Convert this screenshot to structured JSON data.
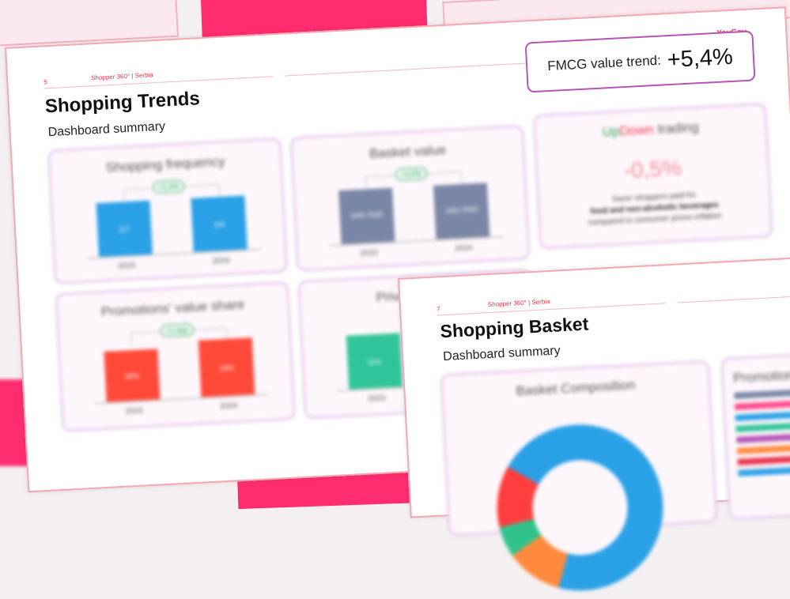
{
  "slide1": {
    "number": "5",
    "crumb": "Shopper 360° | Serbia",
    "brand": "YouGov",
    "title": "Shopping Trends",
    "subtitle": "Dashboard summary",
    "trend_label": "FMCG value trend:",
    "trend_value": "+5,4%",
    "cards": {
      "frequency": {
        "title": "Shopping frequency",
        "delta": "+1,4%",
        "bar1": "117",
        "bar2": "119",
        "year1": "2023",
        "year2": "2024"
      },
      "basket": {
        "title": "Basket value",
        "delta": "+4,0%",
        "bar1": "1491 RSD",
        "bar2": "1551 RSD",
        "year1": "2023",
        "year2": "2024"
      },
      "updown": {
        "title_up": "Up",
        "title_down": "Down",
        "title_rest": " trading",
        "value": "-0,5%",
        "line1": "Saver shoppers paid for",
        "line2": "food and non-alcoholic beverages",
        "line3": "compared to consumer prices inflation"
      },
      "promotions": {
        "title": "Promotions' value share",
        "delta": "+1,4pp",
        "bar1": "28%",
        "bar2": "29%",
        "year1": "2023",
        "year2": "2024"
      },
      "private": {
        "title": "Private Label",
        "bar1": "11%",
        "year1": "2023"
      }
    }
  },
  "slide2": {
    "number": "7",
    "crumb": "Shopper 360° | Serbia",
    "title": "Shopping Basket",
    "subtitle": "Dashboard summary",
    "card_title": "Basket Composition",
    "card2_title": "Promotions"
  },
  "colors": {
    "frequency_bar": "#2aa0e6",
    "basket_bar": "#7a86a6",
    "promo_bar": "#ff4a3a",
    "private_bar": "#31c49a",
    "accent": "#e8334b",
    "box_border": "#b455b6"
  }
}
